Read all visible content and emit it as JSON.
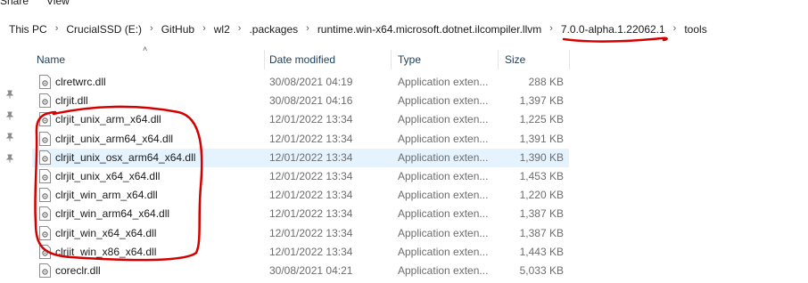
{
  "ribbon": {
    "tabs": [
      "Share",
      "View"
    ]
  },
  "address": {
    "crumbs": [
      "This PC",
      "CrucialSSD (E:)",
      "GitHub",
      "wl2",
      ".packages",
      "runtime.win-x64.microsoft.dotnet.ilcompiler.llvm",
      "7.0.0-alpha.1.22062.1",
      "tools"
    ]
  },
  "columns": {
    "name": "Name",
    "date": "Date modified",
    "type": "Type",
    "size": "Size"
  },
  "files": [
    {
      "name": "clretwrc.dll",
      "date": "30/08/2021 04:19",
      "type": "Application exten...",
      "size": "288 KB"
    },
    {
      "name": "clrjit.dll",
      "date": "30/08/2021 04:16",
      "type": "Application exten...",
      "size": "1,397 KB"
    },
    {
      "name": "clrjit_unix_arm_x64.dll",
      "date": "12/01/2022 13:34",
      "type": "Application exten...",
      "size": "1,225 KB"
    },
    {
      "name": "clrjit_unix_arm64_x64.dll",
      "date": "12/01/2022 13:34",
      "type": "Application exten...",
      "size": "1,391 KB"
    },
    {
      "name": "clrjit_unix_osx_arm64_x64.dll",
      "date": "12/01/2022 13:34",
      "type": "Application exten...",
      "size": "1,390 KB"
    },
    {
      "name": "clrjit_unix_x64_x64.dll",
      "date": "12/01/2022 13:34",
      "type": "Application exten...",
      "size": "1,453 KB"
    },
    {
      "name": "clrjit_win_arm_x64.dll",
      "date": "12/01/2022 13:34",
      "type": "Application exten...",
      "size": "1,220 KB"
    },
    {
      "name": "clrjit_win_arm64_x64.dll",
      "date": "12/01/2022 13:34",
      "type": "Application exten...",
      "size": "1,387 KB"
    },
    {
      "name": "clrjit_win_x64_x64.dll",
      "date": "12/01/2022 13:34",
      "type": "Application exten...",
      "size": "1,387 KB"
    },
    {
      "name": "clrjit_win_x86_x64.dll",
      "date": "12/01/2022 13:34",
      "type": "Application exten...",
      "size": "1,443 KB"
    },
    {
      "name": "coreclr.dll",
      "date": "30/08/2021 04:21",
      "type": "Application exten...",
      "size": "5,033 KB"
    }
  ],
  "selected_file": "clrjit_unix_osx_arm64_x64.dll",
  "colors": {
    "selection": "#e5f3ff",
    "header_text": "#1a3f5c",
    "annotation": "#d40000"
  },
  "icons": {
    "file": "dll-file-icon",
    "pin": "pin-icon",
    "sort": "sort-up-icon",
    "separator": "chevron-right-icon"
  }
}
